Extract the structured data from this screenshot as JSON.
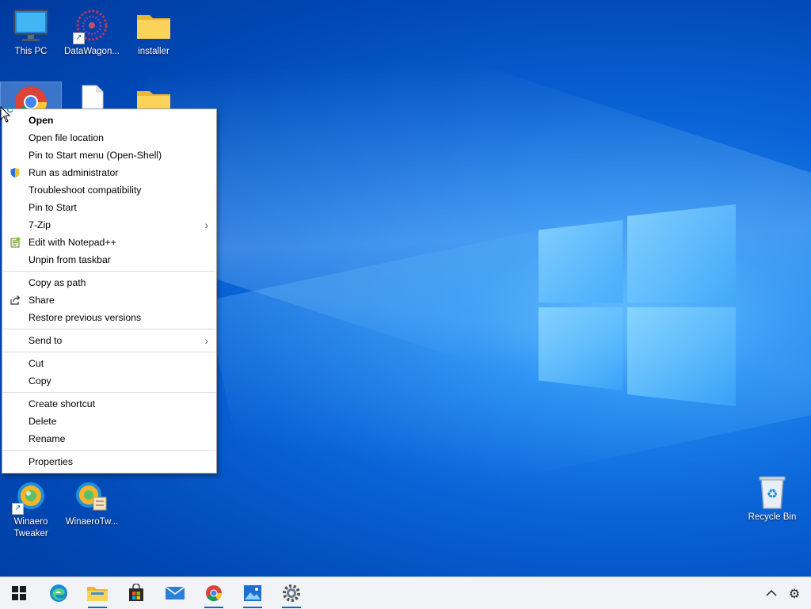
{
  "desktop": {
    "icons": [
      {
        "label": "This PC"
      },
      {
        "label": "DataWagon..."
      },
      {
        "label": "installer"
      },
      {
        "label": "Winaero\nTweaker"
      },
      {
        "label": "WinaeroTw..."
      },
      {
        "label": "Recycle Bin"
      }
    ]
  },
  "context_menu": {
    "items": [
      {
        "label": "Open"
      },
      {
        "label": "Open file location"
      },
      {
        "label": "Pin to Start menu (Open-Shell)"
      },
      {
        "label": "Run as administrator"
      },
      {
        "label": "Troubleshoot compatibility"
      },
      {
        "label": "Pin to Start"
      },
      {
        "label": "7-Zip",
        "submenu_arrow": "›"
      },
      {
        "label": "Edit with Notepad++"
      },
      {
        "label": "Unpin from taskbar"
      },
      {
        "label": "Copy as path"
      },
      {
        "label": "Share"
      },
      {
        "label": "Restore previous versions"
      },
      {
        "label": "Send to",
        "submenu_arrow": "›"
      },
      {
        "label": "Cut"
      },
      {
        "label": "Copy"
      },
      {
        "label": "Create shortcut"
      },
      {
        "label": "Delete"
      },
      {
        "label": "Rename"
      },
      {
        "label": "Properties"
      }
    ]
  },
  "taskbar": {
    "tray_chevron": "^",
    "settings_glyph": "⚙"
  },
  "colors": {
    "accent": "#0a68d2",
    "menu_bg": "#ffffff",
    "taskbar_bg": "#f1f3f7"
  }
}
